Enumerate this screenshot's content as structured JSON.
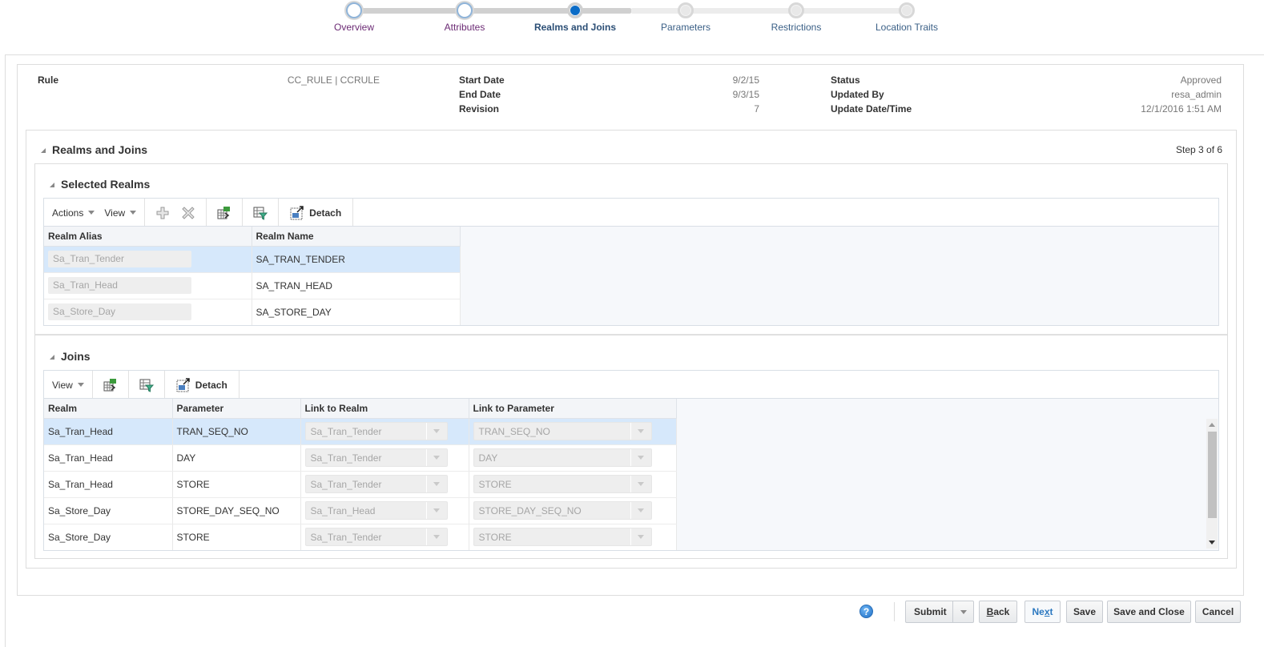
{
  "train": {
    "stops": [
      {
        "label": "Overview",
        "state": "visited"
      },
      {
        "label": "Attributes",
        "state": "visited"
      },
      {
        "label": "Realms and Joins",
        "state": "current"
      },
      {
        "label": "Parameters",
        "state": "unvisited"
      },
      {
        "label": "Restrictions",
        "state": "unvisited"
      },
      {
        "label": "Location Traits",
        "state": "unvisited"
      }
    ]
  },
  "header": {
    "rule_label": "Rule",
    "rule_value": "CC_RULE | CCRULE",
    "start_date_label": "Start Date",
    "start_date_value": "9/2/15",
    "end_date_label": "End Date",
    "end_date_value": "9/3/15",
    "revision_label": "Revision",
    "revision_value": "7",
    "status_label": "Status",
    "status_value": "Approved",
    "updated_by_label": "Updated By",
    "updated_by_value": "resa_admin",
    "update_datetime_label": "Update Date/Time",
    "update_datetime_value": "12/1/2016 1:51 AM"
  },
  "realms_and_joins": {
    "title": "Realms and Joins",
    "step": "Step 3 of 6"
  },
  "selected_realms": {
    "title": "Selected Realms",
    "toolbar": {
      "actions_label": "Actions",
      "view_label": "View",
      "detach_label": "Detach"
    },
    "columns": [
      "Realm Alias",
      "Realm Name"
    ],
    "rows": [
      {
        "alias": "Sa_Tran_Tender",
        "name": "SA_TRAN_TENDER",
        "selected": true
      },
      {
        "alias": "Sa_Tran_Head",
        "name": "SA_TRAN_HEAD",
        "selected": false
      },
      {
        "alias": "Sa_Store_Day",
        "name": "SA_STORE_DAY",
        "selected": false
      }
    ]
  },
  "joins": {
    "title": "Joins",
    "toolbar": {
      "view_label": "View",
      "detach_label": "Detach"
    },
    "columns": [
      "Realm",
      "Parameter",
      "Link to Realm",
      "Link to Parameter"
    ],
    "rows": [
      {
        "realm": "Sa_Tran_Head",
        "parameter": "TRAN_SEQ_NO",
        "link_realm": "Sa_Tran_Tender",
        "link_parameter": "TRAN_SEQ_NO",
        "selected": true
      },
      {
        "realm": "Sa_Tran_Head",
        "parameter": "DAY",
        "link_realm": "Sa_Tran_Tender",
        "link_parameter": "DAY",
        "selected": false
      },
      {
        "realm": "Sa_Tran_Head",
        "parameter": "STORE",
        "link_realm": "Sa_Tran_Tender",
        "link_parameter": "STORE",
        "selected": false
      },
      {
        "realm": "Sa_Store_Day",
        "parameter": "STORE_DAY_SEQ_NO",
        "link_realm": "Sa_Tran_Head",
        "link_parameter": "STORE_DAY_SEQ_NO",
        "selected": false
      },
      {
        "realm": "Sa_Store_Day",
        "parameter": "STORE",
        "link_realm": "Sa_Tran_Tender",
        "link_parameter": "STORE",
        "selected": false
      }
    ]
  },
  "footer": {
    "help_glyph": "?",
    "submit_label": "Submit",
    "back_label_pre": "",
    "back_label_mnemonic": "B",
    "back_label_post": "ack",
    "next_label_pre": "Ne",
    "next_label_mnemonic": "x",
    "next_label_post": "t",
    "save_label": "Save",
    "save_close_label": "Save and Close",
    "cancel_label": "Cancel"
  },
  "colors": {
    "accent": "#0b6cc7",
    "selected_row": "#d6e8fb",
    "visited_link": "#6b2a74"
  }
}
